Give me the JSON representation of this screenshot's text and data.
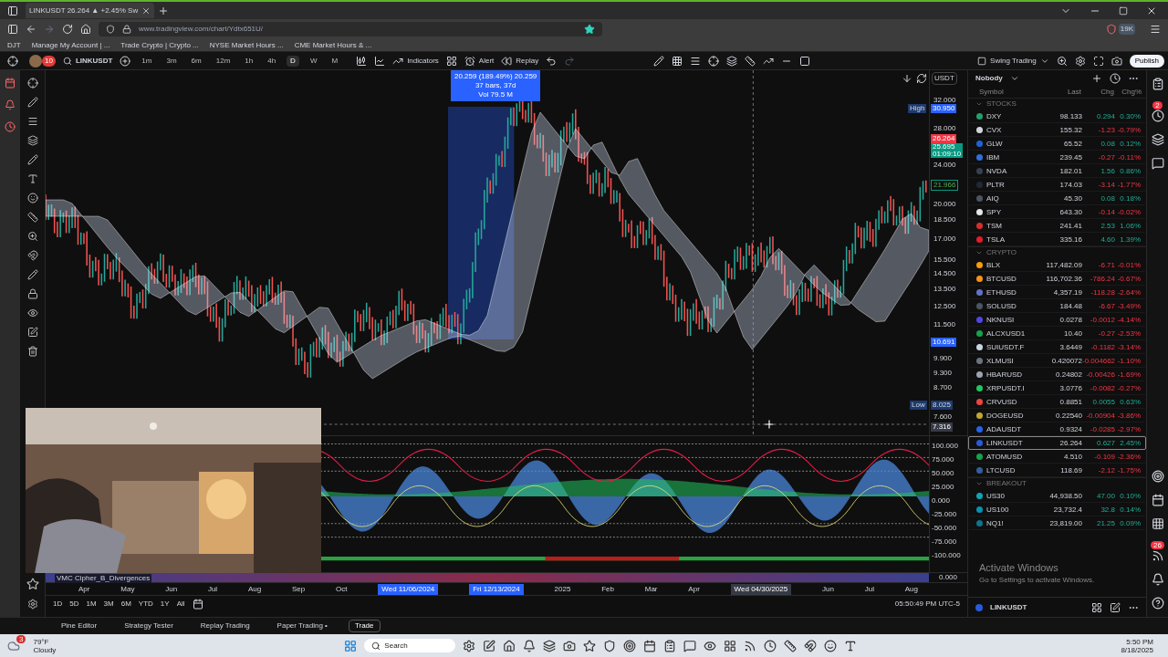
{
  "browser": {
    "tab_title": "LINKUSDT 26.264 ▲ +2.45% Sw",
    "url": "www.tradingview.com/chart/Ydtx651U/",
    "bookmarks": [
      "DJT",
      "Manage My Account | ...",
      "Trade Crypto | Crypto ...",
      "NYSE Market Hours ...",
      "CME Market Hours & ..."
    ],
    "extension_badge": "19K"
  },
  "toolbar": {
    "avatar_badge": "10",
    "symbol": "LINKUSDT",
    "intervals": [
      {
        "label": "1m",
        "selected": false
      },
      {
        "label": "3m",
        "selected": false
      },
      {
        "label": "6m",
        "selected": false
      },
      {
        "label": "12m",
        "selected": false
      },
      {
        "label": "1h",
        "selected": false
      },
      {
        "label": "4h",
        "selected": false
      },
      {
        "label": "D",
        "selected": true
      },
      {
        "label": "W",
        "selected": false
      },
      {
        "label": "M",
        "selected": false
      }
    ],
    "indicators": "Indicators",
    "alert": "Alert",
    "replay": "Replay",
    "layout": "Swing Trading",
    "publish": "Publish"
  },
  "chart": {
    "measure": [
      "20.259 (189.49%) 20.259",
      "37 bars, 37d",
      "Vol 79.5 M"
    ],
    "currency": "USDT",
    "price_ticks": [
      "32.000",
      "28.000",
      "24.000",
      "20.000",
      "18.500",
      "17.000",
      "15.500",
      "14.500",
      "13.500",
      "12.500",
      "11.500",
      "9.900",
      "9.300",
      "8.700",
      "7.600"
    ],
    "high": {
      "label": "High",
      "value": "30.950"
    },
    "last_price": "26.264",
    "bid": {
      "value": "25.695",
      "countdown": "01:09:10"
    },
    "marker": "21.966",
    "range_low": "10.691",
    "low": {
      "label": "Low",
      "value": "8.025"
    },
    "crosshair_price": "7.316",
    "oscillator": {
      "name": "VMC Cipher_B_Divergences",
      "ticks": [
        "100.000",
        "75.000",
        "50.000",
        "25.000",
        "0.000",
        "-25.000",
        "-50.000",
        "-75.000",
        "-100.000"
      ],
      "strip_value": "0.000"
    },
    "time_axis": [
      {
        "label": "Apr",
        "kind": "tick"
      },
      {
        "label": "May",
        "kind": "tick"
      },
      {
        "label": "Jun",
        "kind": "tick"
      },
      {
        "label": "Jul",
        "kind": "tick"
      },
      {
        "label": "Aug",
        "kind": "tick"
      },
      {
        "label": "Sep",
        "kind": "tick"
      },
      {
        "label": "Oct",
        "kind": "tick"
      },
      {
        "label": "Wed 11/06/2024",
        "kind": "range"
      },
      {
        "label": "Fri 12/13/2024",
        "kind": "range"
      },
      {
        "label": "2025",
        "kind": "tick"
      },
      {
        "label": "Feb",
        "kind": "tick"
      },
      {
        "label": "Mar",
        "kind": "tick"
      },
      {
        "label": "Apr",
        "kind": "tick"
      },
      {
        "label": "Wed 04/30/2025",
        "kind": "cursor"
      },
      {
        "label": "Jun",
        "kind": "tick"
      },
      {
        "label": "Jul",
        "kind": "tick"
      },
      {
        "label": "Aug",
        "kind": "tick"
      }
    ],
    "ranges": [
      "1D",
      "5D",
      "1M",
      "3M",
      "6M",
      "YTD",
      "1Y",
      "All"
    ],
    "clock": "05:50:49 PM UTC-5"
  },
  "bottom_tabs": [
    {
      "label": "Pine Editor",
      "selected": false
    },
    {
      "label": "Strategy Tester",
      "selected": false
    },
    {
      "label": "Replay Trading",
      "selected": false
    },
    {
      "label": "Paper Trading •",
      "selected": false
    },
    {
      "label": "Trade",
      "selected": true
    }
  ],
  "watchlist": {
    "title": "Nobody",
    "columns": [
      "Symbol",
      "Last",
      "Chg",
      "Chg%"
    ],
    "alerts_badge": "2",
    "news_badge": "26",
    "sections": [
      {
        "name": "STOCKS",
        "rows": [
          {
            "symbol": "DXY",
            "last": "98.133",
            "chg": "0.294",
            "chg_pct": "0.30%",
            "up": true,
            "color": "#22a06b",
            "selected": false
          },
          {
            "symbol": "CVX",
            "last": "155.32",
            "chg": "-1.23",
            "chg_pct": "-0.79%",
            "up": false,
            "color": "#d1d5db",
            "selected": false
          },
          {
            "symbol": "GLW",
            "last": "65.52",
            "chg": "0.08",
            "chg_pct": "0.12%",
            "up": true,
            "color": "#1e63d6",
            "selected": false
          },
          {
            "symbol": "IBM",
            "last": "239.45",
            "chg": "-0.27",
            "chg_pct": "-0.11%",
            "up": false,
            "color": "#2f6fe0",
            "selected": false
          },
          {
            "symbol": "NVDA",
            "last": "182.01",
            "chg": "1.56",
            "chg_pct": "0.86%",
            "up": true,
            "color": "#374151",
            "selected": false
          },
          {
            "symbol": "PLTR",
            "last": "174.03",
            "chg": "-3.14",
            "chg_pct": "-1.77%",
            "up": false,
            "color": "#1f2937",
            "selected": false
          },
          {
            "symbol": "AIQ",
            "last": "45.30",
            "chg": "0.08",
            "chg_pct": "0.18%",
            "up": true,
            "color": "#4b5563",
            "selected": false
          },
          {
            "symbol": "SPY",
            "last": "643.30",
            "chg": "-0.14",
            "chg_pct": "-0.02%",
            "up": false,
            "color": "#e5e7eb",
            "selected": false
          },
          {
            "symbol": "TSM",
            "last": "241.41",
            "chg": "2.53",
            "chg_pct": "1.06%",
            "up": true,
            "color": "#d32f2f",
            "selected": false
          },
          {
            "symbol": "TSLA",
            "last": "335.16",
            "chg": "4.60",
            "chg_pct": "1.39%",
            "up": true,
            "color": "#e11d2e",
            "selected": false
          }
        ]
      },
      {
        "name": "CRYPTO",
        "rows": [
          {
            "symbol": "BLX",
            "last": "117,482.09",
            "chg": "-6.71",
            "chg_pct": "-0.01%",
            "up": false,
            "color": "#f59e0b",
            "selected": false
          },
          {
            "symbol": "BTCUSD",
            "last": "116,702.36",
            "chg": "-786.24",
            "chg_pct": "-0.67%",
            "up": false,
            "color": "#f7931a",
            "selected": false
          },
          {
            "symbol": "ETHUSD",
            "last": "4,357.19",
            "chg": "-118.28",
            "chg_pct": "-2.64%",
            "up": false,
            "color": "#6272c9",
            "selected": false
          },
          {
            "symbol": "SOLUSD",
            "last": "184.48",
            "chg": "-6.67",
            "chg_pct": "-3.49%",
            "up": false,
            "color": "#4b5563",
            "selected": false
          },
          {
            "symbol": "NKNUSI",
            "last": "0.0278",
            "chg": "-0.0012",
            "chg_pct": "-4.14%",
            "up": false,
            "color": "#4f46e5",
            "selected": false
          },
          {
            "symbol": "ALCXUSD1",
            "last": "10.40",
            "chg": "-0.27",
            "chg_pct": "-2.53%",
            "up": false,
            "color": "#16a34a",
            "selected": false
          },
          {
            "symbol": "SUIUSDT.F",
            "last": "3.6449",
            "chg": "-0.1182",
            "chg_pct": "-3.14%",
            "up": false,
            "color": "#cbd5e1",
            "selected": false
          },
          {
            "symbol": "XLMUSI",
            "last": "0.420072",
            "chg": "-0.004662",
            "chg_pct": "-1.10%",
            "up": false,
            "color": "#6b7280",
            "selected": false
          },
          {
            "symbol": "HBARUSD",
            "last": "0.24802",
            "chg": "-0.00426",
            "chg_pct": "-1.69%",
            "up": false,
            "color": "#9ca3af",
            "selected": false
          },
          {
            "symbol": "XRPUSDT.I",
            "last": "3.0776",
            "chg": "-0.0082",
            "chg_pct": "-0.27%",
            "up": false,
            "color": "#22c55e",
            "selected": false
          },
          {
            "symbol": "CRVUSD",
            "last": "0.8851",
            "chg": "0.0055",
            "chg_pct": "0.63%",
            "up": true,
            "color": "#ef4444",
            "selected": false
          },
          {
            "symbol": "DOGEUSD",
            "last": "0.22540",
            "chg": "-0.00904",
            "chg_pct": "-3.86%",
            "up": false,
            "color": "#c2a633",
            "selected": false
          },
          {
            "symbol": "ADAUSDT",
            "last": "0.9324",
            "chg": "-0.0285",
            "chg_pct": "-2.97%",
            "up": false,
            "color": "#2563eb",
            "selected": false
          },
          {
            "symbol": "LINKUSDT",
            "last": "26.264",
            "chg": "0.627",
            "chg_pct": "2.45%",
            "up": true,
            "color": "#2a5ada",
            "selected": true
          },
          {
            "symbol": "ATOMUSD",
            "last": "4.510",
            "chg": "-0.109",
            "chg_pct": "-2.36%",
            "up": false,
            "color": "#16a34a",
            "selected": false
          },
          {
            "symbol": "LTCUSD",
            "last": "118.69",
            "chg": "-2.12",
            "chg_pct": "-1.75%",
            "up": false,
            "color": "#345d9d",
            "selected": false
          }
        ]
      },
      {
        "name": "BREAKOUT",
        "rows": [
          {
            "symbol": "US30",
            "last": "44,938.50",
            "chg": "47.00",
            "chg_pct": "0.10%",
            "up": true,
            "color": "#0ea5b7",
            "selected": false
          },
          {
            "symbol": "US100",
            "last": "23,732.4",
            "chg": "32.8",
            "chg_pct": "0.14%",
            "up": true,
            "color": "#0891b2",
            "selected": false
          },
          {
            "symbol": "NQ1!",
            "last": "23,819.00",
            "chg": "21.25",
            "chg_pct": "0.09%",
            "up": true,
            "color": "#0e7490",
            "selected": false
          }
        ]
      }
    ],
    "footer_symbol": "LINKUSDT"
  },
  "activation": {
    "title": "Activate Windows",
    "text": "Go to Settings to activate Windows."
  },
  "taskbar": {
    "weather_badge": "3",
    "temperature": "79°F",
    "condition": "Cloudy",
    "search": "Search",
    "time": "5:50 PM",
    "date": "8/18/2025"
  }
}
